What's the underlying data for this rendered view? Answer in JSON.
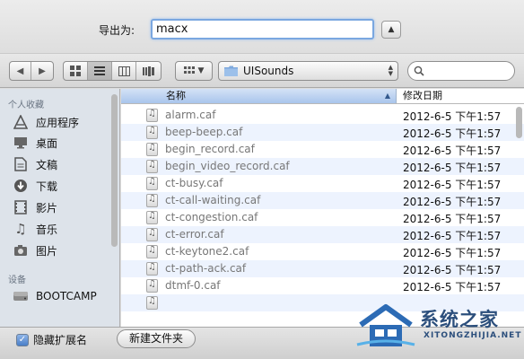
{
  "export": {
    "label": "导出为:",
    "value": "macx"
  },
  "toolbar": {
    "folder": "UISounds"
  },
  "sidebar": {
    "favorites_header": "个人收藏",
    "devices_header": "设备",
    "items": [
      {
        "label": "应用程序",
        "icon": "applications-icon"
      },
      {
        "label": "桌面",
        "icon": "desktop-icon"
      },
      {
        "label": "文稿",
        "icon": "documents-icon"
      },
      {
        "label": "下载",
        "icon": "downloads-icon"
      },
      {
        "label": "影片",
        "icon": "movies-icon"
      },
      {
        "label": "音乐",
        "icon": "music-icon"
      },
      {
        "label": "图片",
        "icon": "pictures-icon"
      }
    ],
    "devices": [
      {
        "label": "BOOTCAMP",
        "icon": "disk-icon"
      }
    ]
  },
  "columns": {
    "name": "名称",
    "date": "修改日期"
  },
  "files": [
    {
      "name": "alarm.caf",
      "date": "2012-6-5 下午1:57"
    },
    {
      "name": "beep-beep.caf",
      "date": "2012-6-5 下午1:57"
    },
    {
      "name": "begin_record.caf",
      "date": "2012-6-5 下午1:57"
    },
    {
      "name": "begin_video_record.caf",
      "date": "2012-6-5 下午1:57"
    },
    {
      "name": "ct-busy.caf",
      "date": "2012-6-5 下午1:57"
    },
    {
      "name": "ct-call-waiting.caf",
      "date": "2012-6-5 下午1:57"
    },
    {
      "name": "ct-congestion.caf",
      "date": "2012-6-5 下午1:57"
    },
    {
      "name": "ct-error.caf",
      "date": "2012-6-5 下午1:57"
    },
    {
      "name": "ct-keytone2.caf",
      "date": "2012-6-5 下午1:57"
    },
    {
      "name": "ct-path-ack.caf",
      "date": "2012-6-5 下午1:57"
    },
    {
      "name": "dtmf-0.caf",
      "date": "2012-6-5 下午1:57"
    }
  ],
  "bottom": {
    "hide_extension": "隐藏扩展名",
    "new_folder": "新建文件夹"
  },
  "watermark": {
    "text": "系统之家",
    "url": "XITONGZHIJIA.NET"
  },
  "colors": {
    "selection": "#a9c5ec",
    "stripe": "#edf3fe",
    "watermark": "#2c4f7c"
  }
}
